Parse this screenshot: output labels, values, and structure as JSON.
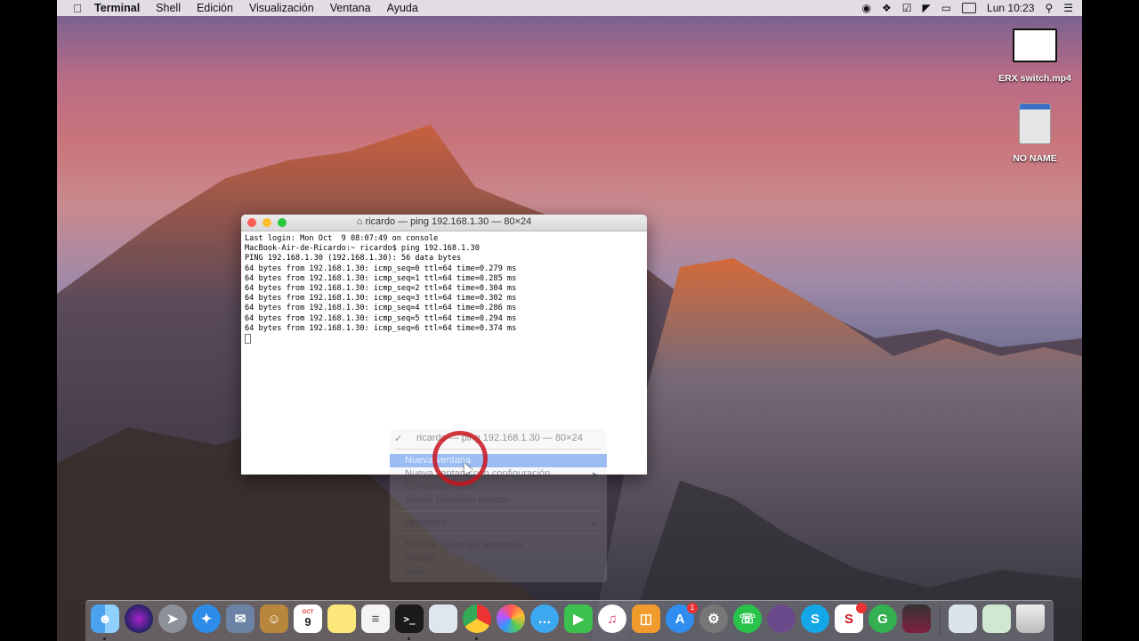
{
  "menubar": {
    "app": "Terminal",
    "items": [
      "Shell",
      "Edición",
      "Visualización",
      "Ventana",
      "Ayuda"
    ],
    "clock": "Lun 10:23"
  },
  "desktop": {
    "icons": [
      {
        "label": "ERX switch.mp4"
      },
      {
        "label": "NO NAME"
      }
    ]
  },
  "terminal": {
    "title": "ricardo — ping 192.168.1.30 — 80×24",
    "lines": [
      "Last login: Mon Oct  9 08:07:49 on console",
      "MacBook-Air-de-Ricardo:~ ricardo$ ping 192.168.1.30",
      "PING 192.168.1.30 (192.168.1.30): 56 data bytes",
      "64 bytes from 192.168.1.30: icmp_seq=0 ttl=64 time=0.279 ms",
      "64 bytes from 192.168.1.30: icmp_seq=1 ttl=64 time=0.285 ms",
      "64 bytes from 192.168.1.30: icmp_seq=2 ttl=64 time=0.304 ms",
      "64 bytes from 192.168.1.30: icmp_seq=3 ttl=64 time=0.302 ms",
      "64 bytes from 192.168.1.30: icmp_seq=4 ttl=64 time=0.286 ms",
      "64 bytes from 192.168.1.30: icmp_seq=5 ttl=64 time=0.294 ms",
      "64 bytes from 192.168.1.30: icmp_seq=6 ttl=64 time=0.374 ms"
    ]
  },
  "context_menu": {
    "window_item": "ricardo — ping 192.168.1.30 — 80×24",
    "items": [
      "Nueva ventana",
      "Nueva ventana con configuración",
      "Comando nuevo",
      "Nueva conexión remota",
      "Opciones",
      "Mostrar todas las ventanas",
      "Ocultar",
      "Salir"
    ]
  },
  "dock": {
    "calendar_day": "9",
    "calendar_month": "OCT",
    "appstore_badge": "1"
  }
}
